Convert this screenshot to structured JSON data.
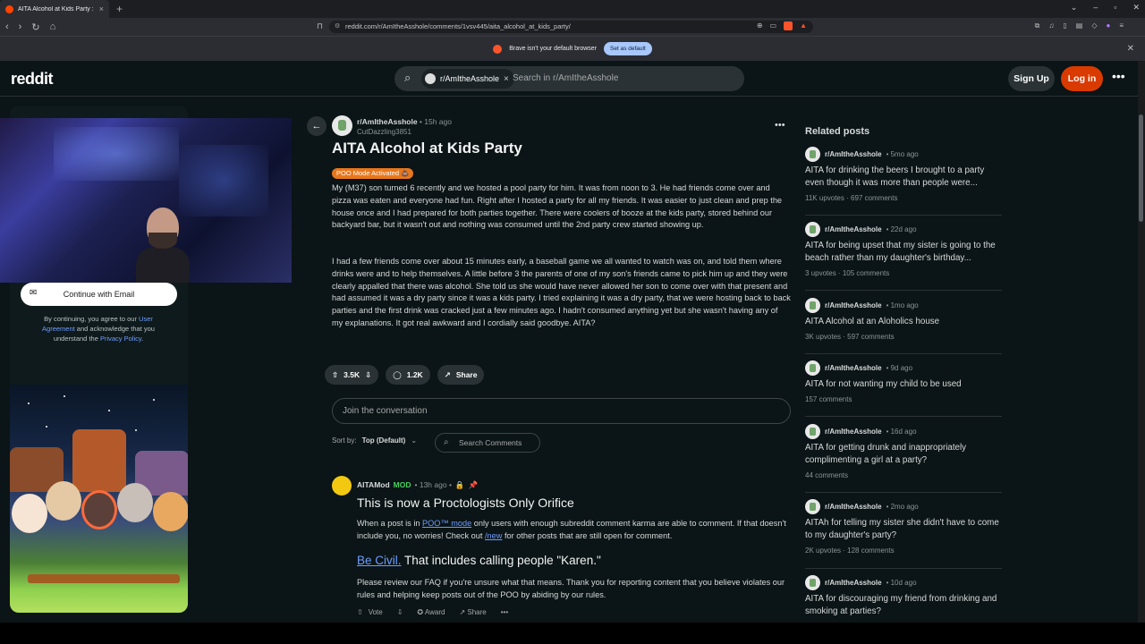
{
  "browser": {
    "tab_title": "AITA Alcohol at Kids Party : r/AmI",
    "url": "reddit.com/r/AmItheAsshole/comments/1vsv445/aita_alcohol_at_kids_party/",
    "infobar_text": "Brave isn't your default browser",
    "infobar_button": "Set as default"
  },
  "header": {
    "logo": "reddit",
    "search_chip": "r/AmItheAsshole",
    "search_placeholder": "Search in r/AmItheAsshole",
    "signup": "Sign Up",
    "login": "Log in"
  },
  "left_panel": {
    "email_button": "Continue with Email",
    "legal_1": "By continuing, you agree to our ",
    "legal_link1": "User Agreement",
    "legal_2": " and acknowledge that you understand the ",
    "legal_link2": "Privacy Policy",
    "legal_3": "."
  },
  "post": {
    "subreddit": "r/AmItheAsshole",
    "age": "• 15h ago",
    "author": "CutDazzling3851",
    "title": "AITA Alcohol at Kids Party",
    "flair": "POO Mode Activated 💩",
    "paragraphs": [
      "My (M37) son turned 6 recently and we hosted a pool party for him.  It was from noon to 3.  He had friends come over and pizza was eaten and everyone had fun. Right after I hosted a party for all my friends.  It was easier to just clean and prep the house once and I had prepared for both parties together.  There were coolers of booze at the kids party, stored behind our backyard bar, but it wasn't out and nothing was consumed until the 2nd party crew started showing up.",
      "I had a few friends come over about 15 minutes early, a baseball game we all wanted to watch was on, and told them where drinks were and to help themselves.  A little before 3 the parents of one of my son's friends came to pick him up and they were clearly appalled that there was alcohol.  She told us she would have never allowed her son to come over with that present and had assumed it was a dry party since it was a kids party.  I tried explaining it was a dry party, that we were hosting back to back parties and the first drink was cracked just a few minutes ago. I hadn't consumed anything yet but she wasn't having any of my explanations.  It got real awkward and I cordially said goodbye. AITA?"
    ],
    "votes": "3.5K",
    "comments": "1.2K",
    "share": "Share",
    "join_placeholder": "Join the conversation",
    "sort_label": "Sort by:",
    "sort_value": "Top (Default)",
    "search_comments": "Search Comments"
  },
  "comment": {
    "author": "AITAMod",
    "mod": "MOD",
    "age": "• 13h ago •",
    "title": "This is now a Proctologists Only Orifice",
    "p1_a": "When a post is in ",
    "p1_link": "POO™ mode",
    "p1_b": " only users with enough subreddit comment karma are able to comment. If that doesn't include you, no worries! Check out ",
    "p1_link2": "/new",
    "p1_c": " for other posts that are still open for comment.",
    "h2_link": "Be Civil.",
    "h2_text": " That includes calling people \"Karen.\"",
    "p2": "Please review our FAQ if you're unsure what that means. Thank you for reporting content that you believe violates our rules and helping keep posts out of the POO by abiding by our rules.",
    "vote": "Vote",
    "award": "Award",
    "share": "Share"
  },
  "related": {
    "title": "Related posts",
    "items": [
      {
        "sub": "r/AmItheAsshole",
        "age": "• 5mo ago",
        "title": "AITA for drinking the beers I brought to a party even though it was more than people were...",
        "upvotes": "11K upvotes",
        "comments": "697 comments"
      },
      {
        "sub": "r/AmItheAsshole",
        "age": "• 22d ago",
        "title": "AITA for being upset that my sister is going to the beach rather than my daughter's birthday...",
        "upvotes": "3 upvotes",
        "comments": "105 comments"
      },
      {
        "sub": "r/AmItheAsshole",
        "age": "• 1mo ago",
        "title": "AITA Alcohol at an Aloholics house",
        "upvotes": "3K upvotes",
        "comments": "597 comments"
      },
      {
        "sub": "r/AmItheAsshole",
        "age": "• 9d ago",
        "title": "AITA for not wanting my child to be used",
        "upvotes": "157 comments",
        "comments": ""
      },
      {
        "sub": "r/AmItheAsshole",
        "age": "• 16d ago",
        "title": "AITA for getting drunk and inappropriately complimenting a girl at a party?",
        "upvotes": "44 comments",
        "comments": ""
      },
      {
        "sub": "r/AmItheAsshole",
        "age": "• 2mo ago",
        "title": "AITAh for telling my sister she didn't have to come to my daughter's party?",
        "upvotes": "2K upvotes",
        "comments": "128 comments"
      },
      {
        "sub": "r/AmItheAsshole",
        "age": "• 10d ago",
        "title": "AITA for discouraging my friend from drinking and smoking at parties?",
        "upvotes": "",
        "comments": ""
      }
    ]
  }
}
